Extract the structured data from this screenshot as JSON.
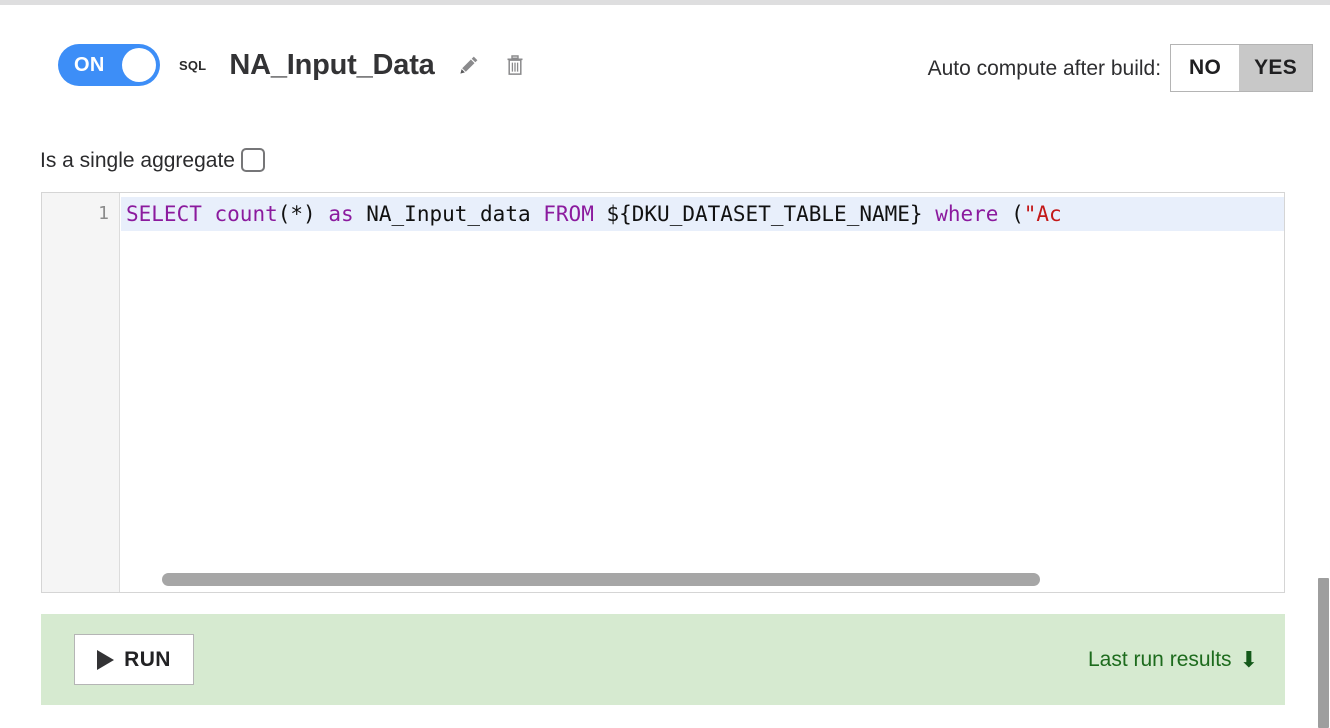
{
  "header": {
    "toggle": {
      "label": "ON",
      "state": "on",
      "color": "#3d8ef7"
    },
    "engine_badge": "SQL",
    "recipe_name": "NA_Input_Data",
    "edit_icon": "pencil-icon",
    "delete_icon": "trash-icon",
    "auto_compute": {
      "label": "Auto compute after build:",
      "options": [
        "NO",
        "YES"
      ],
      "no_label": "NO",
      "yes_label": "YES",
      "selected": "NO"
    }
  },
  "options": {
    "single_aggregate_label": "Is a single aggregate",
    "single_aggregate_checked": false
  },
  "editor": {
    "line_number": "1",
    "active_line_bg": "#e8effb",
    "code_tokens": [
      {
        "text": "SELECT",
        "type": "keyword"
      },
      {
        "text": " ",
        "type": "plain"
      },
      {
        "text": "count",
        "type": "function"
      },
      {
        "text": "(*) ",
        "type": "punct"
      },
      {
        "text": "as",
        "type": "keyword"
      },
      {
        "text": " NA_Input_data ",
        "type": "identifier"
      },
      {
        "text": "FROM",
        "type": "keyword"
      },
      {
        "text": " ${DKU_DATASET_TABLE_NAME} ",
        "type": "identifier"
      },
      {
        "text": "where",
        "type": "keyword"
      },
      {
        "text": " (",
        "type": "punct"
      },
      {
        "text": "\"Ac",
        "type": "string"
      }
    ],
    "code_text": "SELECT count(*) as NA_Input_data FROM ${DKU_DATASET_TABLE_NAME} where (\"Ac",
    "syntax_colors": {
      "keyword": "#8b1a9e",
      "function": "#8b1a9e",
      "identifier": "#111111",
      "string": "#c31818"
    },
    "horizontal_scroll_present": true
  },
  "run_bar": {
    "background": "#d6ead0",
    "run_label": "RUN",
    "run_icon": "play-icon",
    "last_run_label": "Last run results",
    "last_run_icon": "arrow-down-icon",
    "last_run_color": "#1d6b1d"
  },
  "scrollbars": {
    "page_vertical_present": true
  }
}
